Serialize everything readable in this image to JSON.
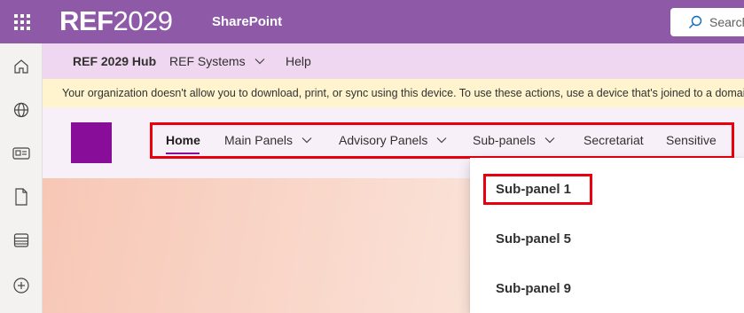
{
  "suite": {
    "brand_prefix": "REF",
    "brand_suffix": "2029",
    "app_name": "SharePoint",
    "search_placeholder": "Search",
    "icons": [
      "waffle-icon",
      "search-icon"
    ],
    "color": "#8e5aa8"
  },
  "rail": {
    "icons": [
      "home-icon",
      "globe-icon",
      "news-icon",
      "file-icon",
      "list-icon",
      "add-icon"
    ]
  },
  "hub": {
    "title": "REF 2029 Hub",
    "links": [
      {
        "label": "REF Systems",
        "has_dropdown": true
      },
      {
        "label": "Help",
        "has_dropdown": false
      }
    ],
    "color": "#efd7f1"
  },
  "info": {
    "text": "Your organization doesn't allow you to download, print, or sync using this device. To use these actions, use a device that's joined to a domain or",
    "icon": "info-icon",
    "color": "#fff4ce"
  },
  "site": {
    "logo_color": "#880e99",
    "nav": [
      {
        "label": "Home",
        "active": true,
        "has_dropdown": false
      },
      {
        "label": "Main Panels",
        "active": false,
        "has_dropdown": true
      },
      {
        "label": "Advisory Panels",
        "active": false,
        "has_dropdown": true
      },
      {
        "label": "Sub-panels",
        "active": false,
        "has_dropdown": true
      },
      {
        "label": "Secretariat",
        "active": false,
        "has_dropdown": false
      },
      {
        "label": "Sensitive",
        "active": false,
        "has_dropdown": false
      }
    ]
  },
  "dropdown": {
    "items": [
      "Sub-panel 1",
      "Sub-panel 5",
      "Sub-panel 9"
    ],
    "highlighted_index": 0,
    "highlight_color": "#e8000d"
  }
}
